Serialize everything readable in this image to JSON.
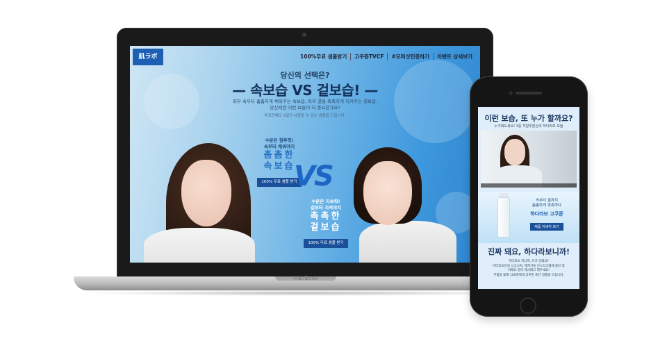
{
  "laptop": {
    "brand_label": "MacBook",
    "site": {
      "logo_text": "肌ラボ",
      "nav": [
        "100%무료 샘플받기",
        "고쿠쥰TVCF",
        "#오피샷인증하기",
        "이벤트 상세보기"
      ],
      "hero_subtitle": "당신의 선택은?",
      "hero_title": "— 속보습 VS 겉보습! —",
      "hero_desc_1": "피부 속부터 촘촘하게 채워주는 속보습, 피부 결을 촉촉하게 지켜주는 겉보습.",
      "hero_desc_2": "당신에겐 어떤 보습이 더 중요한가요?",
      "hero_note": "투표만해도 5일간 사용할 수 있는 샘플을 드립니다.",
      "left_copy": {
        "line1": "수분은 침투력!",
        "line2": "속부터 채워야지",
        "big1": "촘촘한",
        "big2": "속보습",
        "button": "100% 무료 샘플 받기"
      },
      "vs_text": "VS",
      "right_copy": {
        "line1": "수분은 지속력!",
        "line2": "겉부터 지켜야지",
        "big1": "촉촉한",
        "big2": "겉보습",
        "button": "100% 무료 샘플 받기"
      }
    }
  },
  "phone": {
    "title": "이런 보습, 또 누가 할까요?",
    "subtitle": "누가봐도세요! 3중 히알루론산의 하다라보 보습",
    "product": {
      "line1": "속부터 결까지",
      "line2": "촘촘하게 촉촉하다",
      "name": "하다라보 고쿠쥰",
      "button": "제품 자세히 보기"
    },
    "bottom_title": "진짜 돼요, 하다라보니까!",
    "bottom_desc_1": "하다라보 하니까, 이거 안돼요?",
    "bottom_desc_2": "하다라보만의 시그니처, 헤지가톡 인스타그램에 올린 후",
    "bottom_desc_3": "아래의 같이 해시태그 해주세요!",
    "bottom_desc_4": "추첨을 통해 100명에게 고쿠쥰 로션 정품을 드립니다."
  }
}
